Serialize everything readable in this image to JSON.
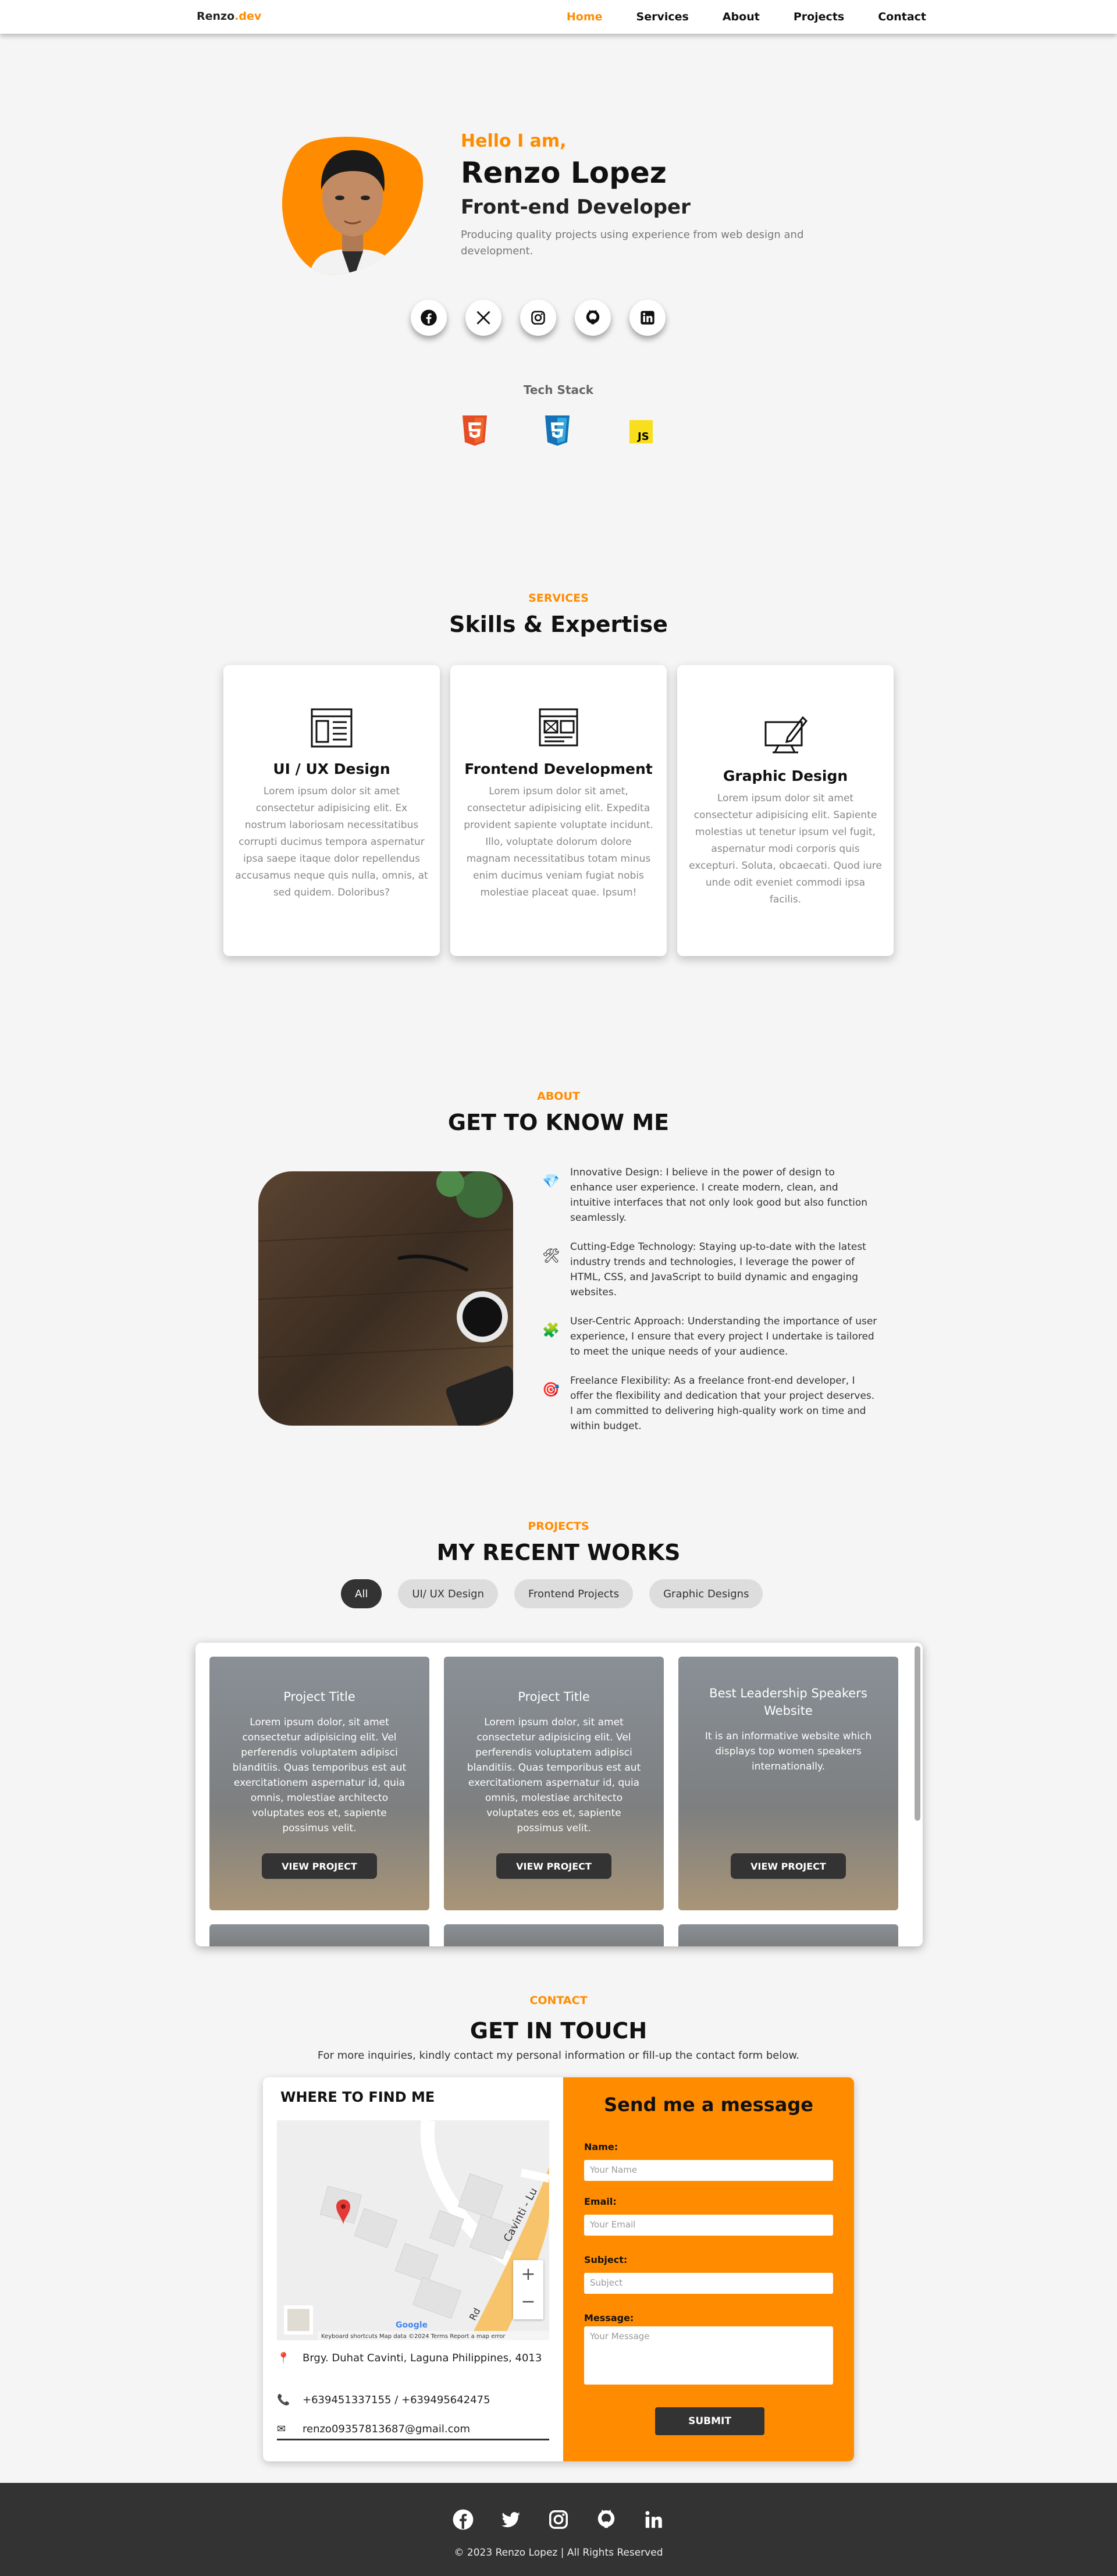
{
  "nav": {
    "logo_main": "Renzo",
    "logo_suffix": ".dev",
    "items": [
      "Home",
      "Services",
      "About",
      "Projects",
      "Contact"
    ]
  },
  "hero": {
    "greeting": "Hello I am,",
    "name": "Renzo Lopez",
    "role": "Front-end Developer",
    "tagline": "Producing quality projects using experience from web design and development.",
    "socials": [
      "facebook-icon",
      "x-icon",
      "instagram-icon",
      "github-icon",
      "linkedin-icon"
    ],
    "tech_title": "Tech Stack",
    "tech": [
      "html5-icon",
      "css3-icon",
      "javascript-icon"
    ]
  },
  "services": {
    "kicker": "SERVICES",
    "title": "Skills & Expertise",
    "cards": [
      {
        "title": "UI / UX Design",
        "text": "Lorem ipsum dolor sit amet consectetur adipisicing elit. Ex nostrum laboriosam necessitatibus corrupti ducimus tempora aspernatur ipsa saepe itaque dolor repellendus accusamus neque quis nulla, omnis, at sed quidem. Doloribus?"
      },
      {
        "title": "Frontend Development",
        "text": "Lorem ipsum dolor sit amet, consectetur adipisicing elit. Expedita provident sapiente voluptate incidunt. Illo, voluptate dolorum dolore magnam necessitatibus totam minus enim ducimus veniam fugiat nobis molestiae placeat quae. Ipsum!"
      },
      {
        "title": "Graphic Design",
        "text": "Lorem ipsum dolor sit amet consectetur adipisicing elit. Sapiente molestias ut tenetur ipsum vel fugit, aspernatur modi corporis quis excepturi. Soluta, obcaecati. Quod iure unde odit eveniet commodi ipsa facilis."
      }
    ]
  },
  "about": {
    "kicker": "ABOUT",
    "title": "GET TO KNOW ME",
    "items": [
      "Innovative Design: I believe in the power of design to enhance user experience. I create modern, clean, and intuitive interfaces that not only look good but also function seamlessly.",
      "Cutting-Edge Technology: Staying up-to-date with the latest industry trends and technologies, I leverage the power of HTML, CSS, and JavaScript to build dynamic and engaging websites.",
      "User-Centric Approach: Understanding the importance of user experience, I ensure that every project I undertake is tailored to meet the unique needs of your audience.",
      "Freelance Flexibility: As a freelance front-end developer, I offer the flexibility and dedication that your project deserves. I am committed to delivering high-quality work on time and within budget."
    ]
  },
  "projects": {
    "kicker": "PROJECTS",
    "title": "MY RECENT WORKS",
    "filters": [
      "All",
      "UI/ UX Design",
      "Frontend Projects",
      "Graphic Designs"
    ],
    "cards": [
      {
        "title": "Project Title",
        "text": "Lorem ipsum dolor, sit amet consectetur adipisicing elit. Vel perferendis voluptatem adipisci blanditiis. Quas temporibus est aut exercitationem aspernatur id, quia omnis, molestiae architecto voluptates eos et, sapiente possimus velit.",
        "button": "VIEW PROJECT"
      },
      {
        "title": "Project Title",
        "text": "Lorem ipsum dolor, sit amet consectetur adipisicing elit. Vel perferendis voluptatem adipisci blanditiis. Quas temporibus est aut exercitationem aspernatur id, quia omnis, molestiae architecto voluptates eos et, sapiente possimus velit.",
        "button": "VIEW PROJECT"
      },
      {
        "title": "Best Leadership Speakers Website",
        "text": "It is an informative website which displays top women speakers internationally.",
        "button": "VIEW PROJECT"
      }
    ]
  },
  "contact": {
    "kicker": "CONTACT",
    "title": "GET IN TOUCH",
    "subtitle": "For more inquiries, kindly contact my personal information or fill-up the contact form below.",
    "find_title": "WHERE TO FIND ME",
    "map": {
      "road_label": "Cavinti - Lu",
      "road_label2": "Rd",
      "attribution": "Keyboard shortcuts   Map data ©2024   Terms   Report a map error",
      "logo": "Google"
    },
    "address": "Brgy. Duhat Cavinti, Laguna Philippines, 4013",
    "phone": "+639451337155 / +639495642475",
    "email": "renzo09357813687@gmail.com",
    "form": {
      "title": "Send me a message",
      "name_label": "Name:",
      "name_placeholder": "Your Name",
      "email_label": "Email:",
      "email_placeholder": "Your Email",
      "subject_label": "Subject:",
      "subject_placeholder": "Subject",
      "message_label": "Message:",
      "message_placeholder": "Your Message",
      "submit": "SUBMIT"
    }
  },
  "footer": {
    "icons": [
      "facebook-icon",
      "x-icon",
      "instagram-icon",
      "github-icon",
      "linkedin-icon"
    ],
    "copyright": "© 2023 Renzo Lopez | All Rights Reserved"
  },
  "colors": {
    "accent": "#ff8c00",
    "dark": "#333333",
    "background": "#f5f5f5"
  }
}
